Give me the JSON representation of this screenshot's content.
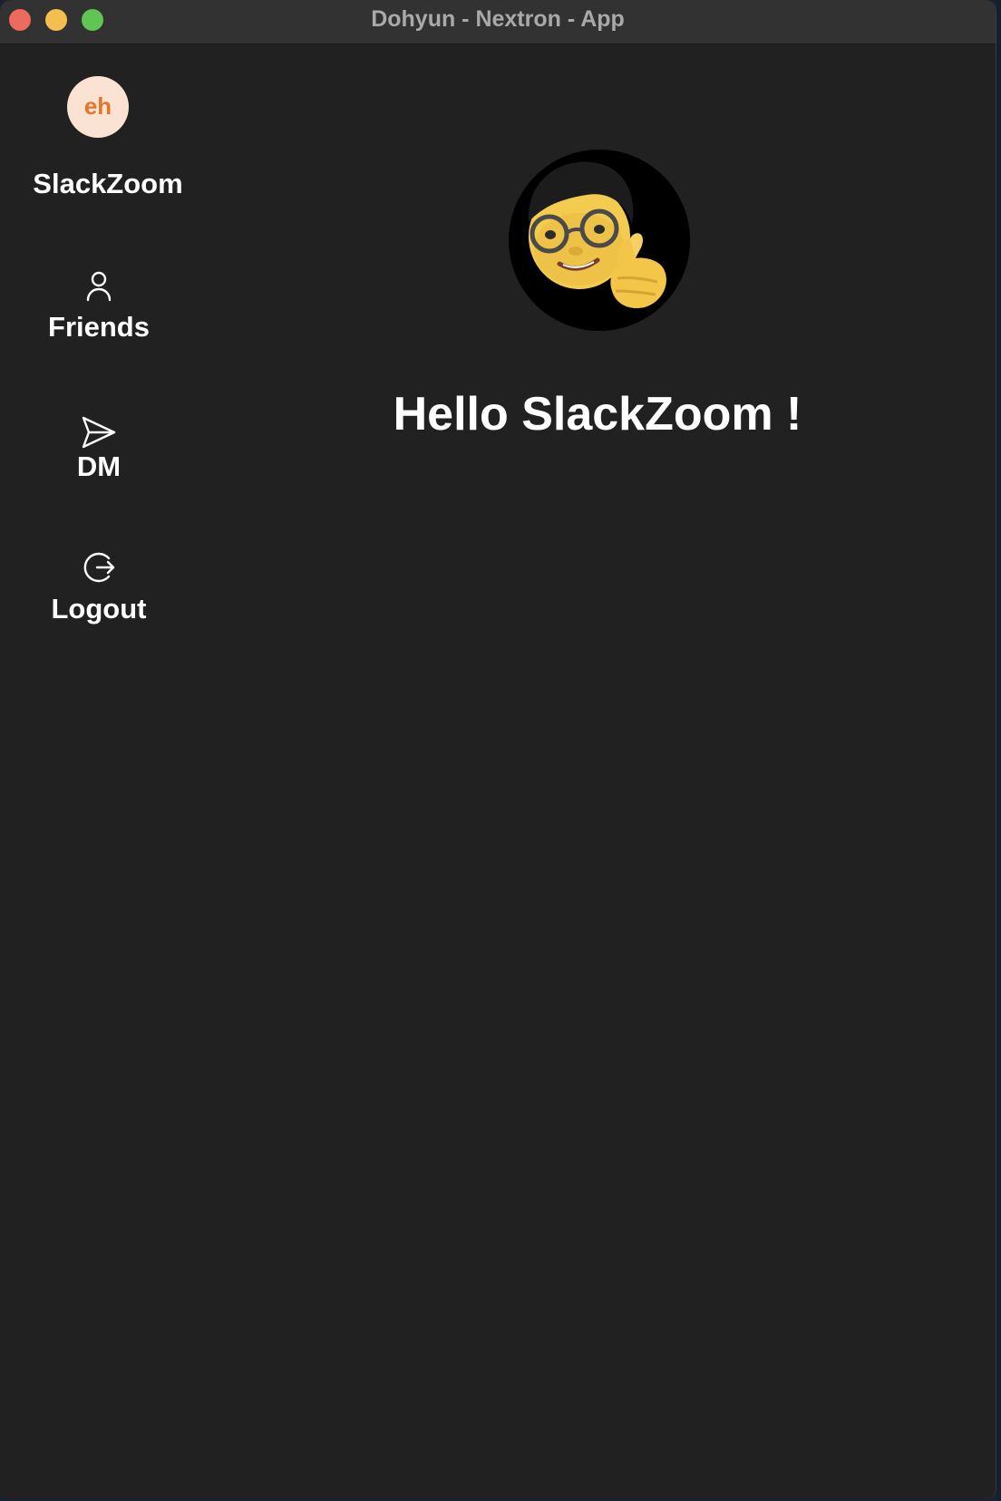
{
  "window": {
    "title": "Dohyun - Nextron - App"
  },
  "sidebar": {
    "workspace_initials": "eh",
    "workspace_name": "SlackZoom",
    "items": [
      {
        "label": "Friends",
        "icon": "user-icon"
      },
      {
        "label": "DM",
        "icon": "send-icon"
      },
      {
        "label": "Logout",
        "icon": "logout-icon"
      }
    ]
  },
  "main": {
    "avatar_description_icon": "memoji-thumbs-up-avatar",
    "greeting": "Hello SlackZoom !"
  },
  "colors": {
    "background": "#212121",
    "titlebar": "#323232",
    "avatar_bg": "#fbe3d4",
    "avatar_text": "#e2762d",
    "text": "#ffffff"
  }
}
